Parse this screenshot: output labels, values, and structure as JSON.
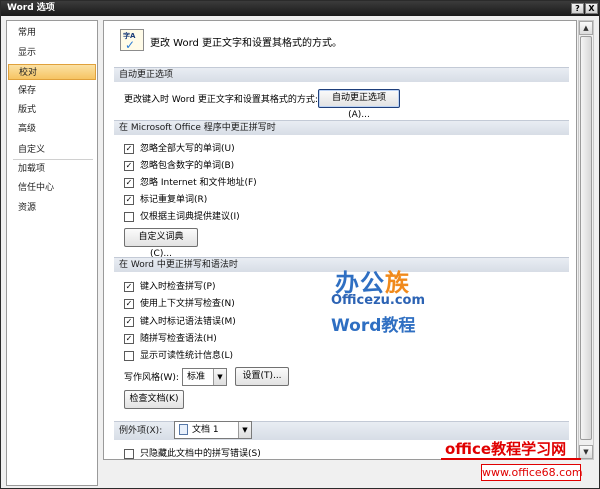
{
  "window": {
    "title": "Word 选项",
    "help_label": "?",
    "close_label": "X"
  },
  "sidebar": {
    "items": [
      {
        "label": "常用"
      },
      {
        "label": "显示"
      },
      {
        "label": "校对",
        "active": true
      },
      {
        "label": "保存"
      },
      {
        "label": "版式"
      },
      {
        "label": "高级"
      },
      {
        "label": "自定义"
      },
      {
        "label": "加载项"
      },
      {
        "label": "信任中心"
      },
      {
        "label": "资源"
      }
    ]
  },
  "header": {
    "icon_text": "字A",
    "icon": "spellcheck-icon",
    "title": "更改 Word 更正文字和设置其格式的方式。"
  },
  "autocorrect": {
    "section_title": "自动更正选项",
    "row_label": "更改键入时 Word 更正文字和设置其格式的方式:",
    "button_label": "自动更正选项(A)..."
  },
  "office_spelling": {
    "section_title": "在 Microsoft Office 程序中更正拼写时",
    "options": [
      {
        "label": "忽略全部大写的单词(U)",
        "checked": true
      },
      {
        "label": "忽略包含数字的单词(B)",
        "checked": true
      },
      {
        "label": "忽略 Internet 和文件地址(F)",
        "checked": true
      },
      {
        "label": "标记重复单词(R)",
        "checked": true
      },
      {
        "label": "仅根据主词典提供建议(I)",
        "checked": false
      }
    ],
    "dict_button_label": "自定义词典(C)..."
  },
  "word_spelling": {
    "section_title": "在 Word 中更正拼写和语法时",
    "options": [
      {
        "label": "键入时检查拼写(P)",
        "checked": true
      },
      {
        "label": "使用上下文拼写检查(N)",
        "checked": true
      },
      {
        "label": "键入时标记语法错误(M)",
        "checked": true
      },
      {
        "label": "随拼写检查语法(H)",
        "checked": true
      },
      {
        "label": "显示可读性统计信息(L)",
        "checked": false
      }
    ],
    "style_label": "写作风格(W):",
    "style_value": "标准",
    "settings_button_label": "设置(T)...",
    "recheck_button_label": "检查文档(K)"
  },
  "exceptions": {
    "label": "例外项(X):",
    "document_value": "文档 1",
    "hide_spelling_label": "只隐藏此文档中的拼写错误(S)",
    "hide_spelling_checked": false
  },
  "checkmark": "✓",
  "scroll": {
    "up": "▲",
    "down": "▼"
  },
  "dropdown_arrow": "▼",
  "watermark": {
    "brand_a": "办公",
    "brand_b": "族",
    "site": "Officezu.com",
    "product": "Word教程",
    "site_cn": "office教程学习网",
    "url": "www.office68.com"
  },
  "colors": {
    "active_nav": "#f6c463",
    "section_bg": "#dde3ec",
    "watermark_blue": "#2f6fc2",
    "watermark_red": "#e00000"
  }
}
